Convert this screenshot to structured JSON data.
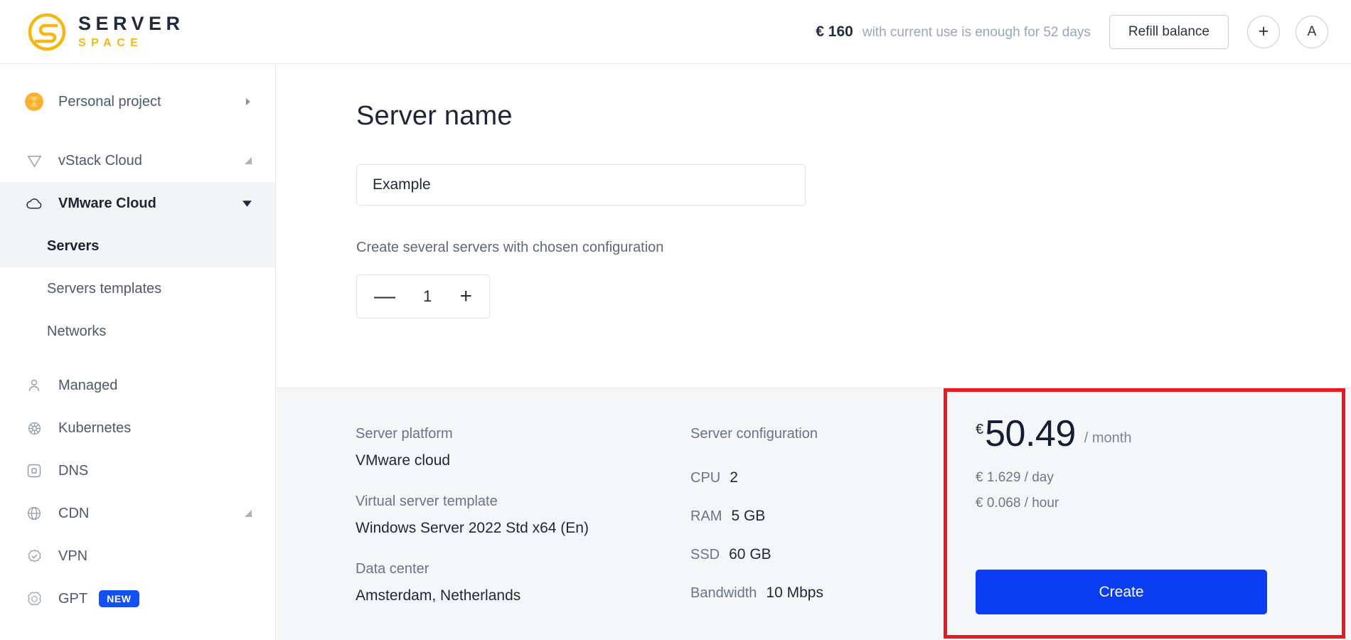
{
  "header": {
    "logo": {
      "primary": "SERVER",
      "secondary": "SPACE",
      "mark_icon": "serverspace-s-logo-icon",
      "primary_color": "#232a3d",
      "secondary_color": "#f5b715"
    },
    "balance": {
      "amount": "€ 160",
      "note": "with current use is enough for 52 days"
    },
    "refill_label": "Refill balance",
    "add_icon": "plus-icon",
    "add_label": "+",
    "avatar_label": "A"
  },
  "sidebar": {
    "project": {
      "label": "Personal project",
      "icon": "project-avatar-icon",
      "caret": "chevron-right-icon"
    },
    "groups": [
      {
        "label": "vStack Cloud",
        "icon": "vstack-icon",
        "caret": "collapse-corner-icon",
        "active": false
      },
      {
        "label": "VMware Cloud",
        "icon": "cloud-icon",
        "caret": "chevron-down-icon",
        "active": true
      }
    ],
    "subitems": [
      {
        "label": "Servers",
        "active": true
      },
      {
        "label": "Servers templates",
        "active": false
      },
      {
        "label": "Networks",
        "active": false
      }
    ],
    "items": [
      {
        "label": "Managed",
        "icon": "user-icon",
        "caret": ""
      },
      {
        "label": "Kubernetes",
        "icon": "kubernetes-helm-icon",
        "caret": ""
      },
      {
        "label": "DNS",
        "icon": "dns-square-icon",
        "caret": ""
      },
      {
        "label": "CDN",
        "icon": "globe-icon",
        "caret": "collapse-corner-icon"
      },
      {
        "label": "VPN",
        "icon": "shield-check-icon",
        "caret": ""
      },
      {
        "label": "GPT",
        "icon": "gpt-swirl-icon",
        "badge": "NEW",
        "caret": ""
      }
    ],
    "badge_color": "#1150f5"
  },
  "main": {
    "title": "Server name",
    "name_input_value": "Example",
    "name_input_placeholder": "Example",
    "multi_server_label": "Create several servers with chosen configuration",
    "stepper": {
      "decrement": "—",
      "value": "1",
      "increment": "+"
    }
  },
  "summary": {
    "platform": {
      "label": "Server platform",
      "value": "VMware cloud"
    },
    "template": {
      "label": "Virtual server template",
      "value": "Windows Server 2022 Std x64 (En)"
    },
    "datacenter": {
      "label": "Data center",
      "value": "Amsterdam, Netherlands"
    },
    "configuration": {
      "label": "Server configuration",
      "specs": [
        {
          "key": "CPU",
          "value": "2"
        },
        {
          "key": "RAM",
          "value": "5 GB"
        },
        {
          "key": "SSD",
          "value": "60 GB"
        },
        {
          "key": "Bandwidth",
          "value": "10 Mbps"
        }
      ]
    }
  },
  "price": {
    "currency": "€",
    "amount": "50.49",
    "period": "/ month",
    "per_day": "€ 1.629 / day",
    "per_hour": "€ 0.068 / hour",
    "create_label": "Create",
    "create_color": "#0a3ef5",
    "highlight_color": "#ee1620"
  }
}
